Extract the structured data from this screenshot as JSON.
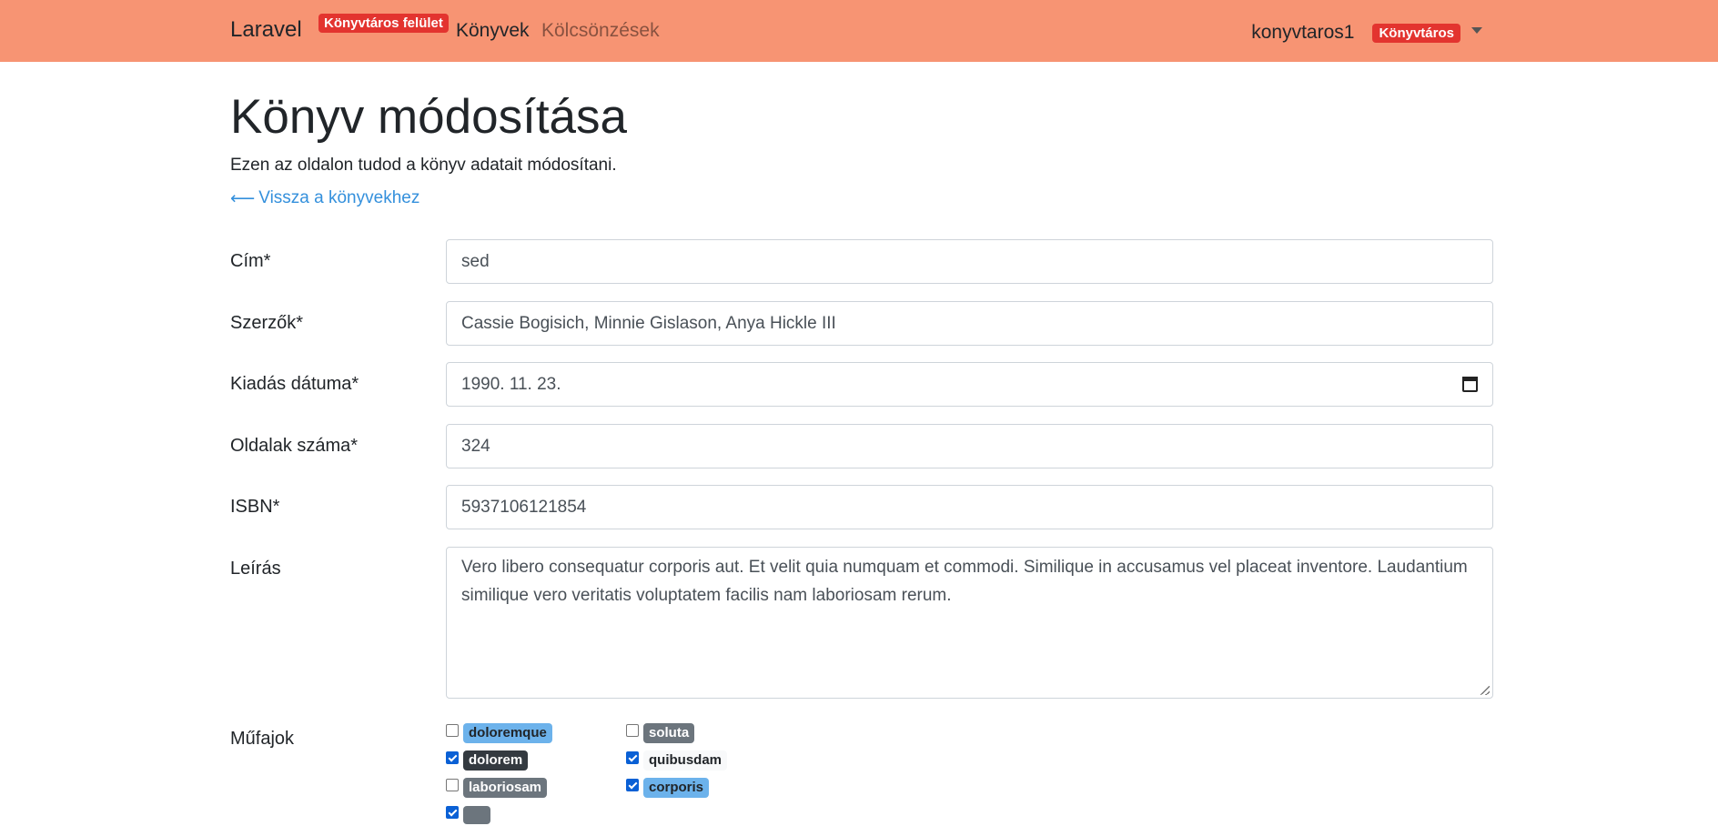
{
  "navbar": {
    "brand": "Laravel",
    "brand_badge": "Könyvtáros felület",
    "links": {
      "books": "Könyvek",
      "loans": "Kölcsönzések"
    },
    "username": "konyvtaros1",
    "role_badge": "Könyvtáros",
    "colors": {
      "background": "#f79473",
      "badge": "#e3342f"
    }
  },
  "page": {
    "title": "Könyv módosítása",
    "description": "Ezen az oldalon tudod a könyv adatait módosítani.",
    "back_link": "Vissza a könyvekhez",
    "back_icon": "long-arrow-left-icon"
  },
  "form": {
    "title": {
      "label": "Cím*",
      "value": "sed"
    },
    "authors": {
      "label": "Szerzők*",
      "value": "Cassie Bogisich, Minnie Gislason, Anya Hickle III"
    },
    "release_date": {
      "label": "Kiadás dátuma*",
      "value": "1990. 11. 23."
    },
    "pages": {
      "label": "Oldalak száma*",
      "value": "324"
    },
    "isbn": {
      "label": "ISBN*",
      "value": "5937106121854"
    },
    "description": {
      "label": "Leírás",
      "value": "Vero libero consequatur corporis aut. Et velit quia numquam et commodi. Similique in accusamus vel placeat inventore. Laudantium similique vero veritatis voluptatem facilis nam laboriosam rerum."
    },
    "genres": {
      "label": "Műfajok",
      "items": [
        {
          "name": "doloremque",
          "checked": false,
          "bg": "#6cb2eb",
          "fg": "#212529"
        },
        {
          "name": "soluta",
          "checked": false,
          "bg": "#6c757d",
          "fg": "#ffffff"
        },
        {
          "name": "dolorem",
          "checked": true,
          "bg": "#343a40",
          "fg": "#ffffff"
        },
        {
          "name": "quibusdam",
          "checked": true,
          "bg": "#f8f9fa",
          "fg": "#212529"
        },
        {
          "name": "laboriosam",
          "checked": false,
          "bg": "#6c757d",
          "fg": "#ffffff"
        },
        {
          "name": "corporis",
          "checked": true,
          "bg": "#6cb2eb",
          "fg": "#212529"
        },
        {
          "name": "",
          "checked": true,
          "bg": "#6c757d",
          "fg": "#ffffff"
        }
      ]
    }
  }
}
